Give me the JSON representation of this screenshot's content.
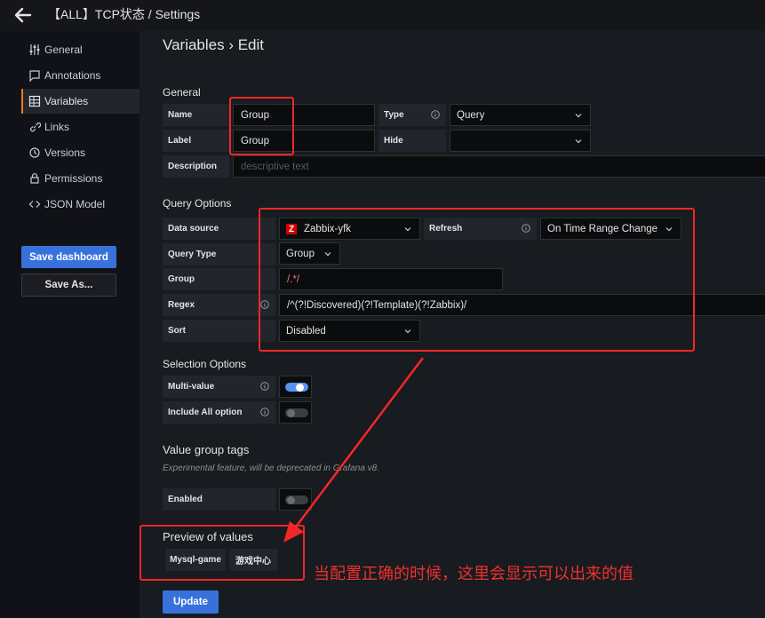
{
  "topbar": {
    "title": "【ALL】TCP状态 / Settings"
  },
  "sidebar": {
    "items": [
      {
        "label": "General",
        "icon": "sliders-icon"
      },
      {
        "label": "Annotations",
        "icon": "comment-icon"
      },
      {
        "label": "Variables",
        "icon": "variables-icon",
        "active": true
      },
      {
        "label": "Links",
        "icon": "link-icon"
      },
      {
        "label": "Versions",
        "icon": "history-icon"
      },
      {
        "label": "Permissions",
        "icon": "lock-icon"
      },
      {
        "label": "JSON Model",
        "icon": "code-icon"
      }
    ],
    "save_dashboard": "Save dashboard",
    "save_as": "Save As..."
  },
  "page": {
    "title": "Variables › Edit"
  },
  "general": {
    "title": "General",
    "name_label": "Name",
    "name_value": "Group",
    "type_label": "Type",
    "type_value": "Query",
    "label_label": "Label",
    "label_value": "Group",
    "hide_label": "Hide",
    "hide_value": "",
    "description_label": "Description",
    "description_placeholder": "descriptive text"
  },
  "query_options": {
    "title": "Query Options",
    "datasource_label": "Data source",
    "datasource_value": "Zabbix-yfk",
    "refresh_label": "Refresh",
    "refresh_value": "On Time Range Change",
    "query_type_label": "Query Type",
    "query_type_value": "Group",
    "group_label": "Group",
    "group_value": "/.*/",
    "regex_label": "Regex",
    "regex_value": "/^(?!Discovered)(?!Template)(?!Zabbix)/",
    "sort_label": "Sort",
    "sort_value": "Disabled"
  },
  "selection_options": {
    "title": "Selection Options",
    "multi_label": "Multi-value",
    "multi_value": true,
    "include_all_label": "Include All option",
    "include_all_value": false
  },
  "value_group_tags": {
    "title": "Value group tags",
    "hint": "Experimental feature, will be deprecated in Grafana v8.",
    "enabled_label": "Enabled",
    "enabled_value": false
  },
  "preview": {
    "title": "Preview of values",
    "values": [
      "Mysql-game",
      "游戏中心"
    ]
  },
  "update_button": "Update",
  "annotation_text": "当配置正确的时候，这里会显示可以出来的值",
  "colors": {
    "accent": "#3871dc",
    "annotation_red": "#f2272a",
    "active_nav": "#eb7b18"
  }
}
